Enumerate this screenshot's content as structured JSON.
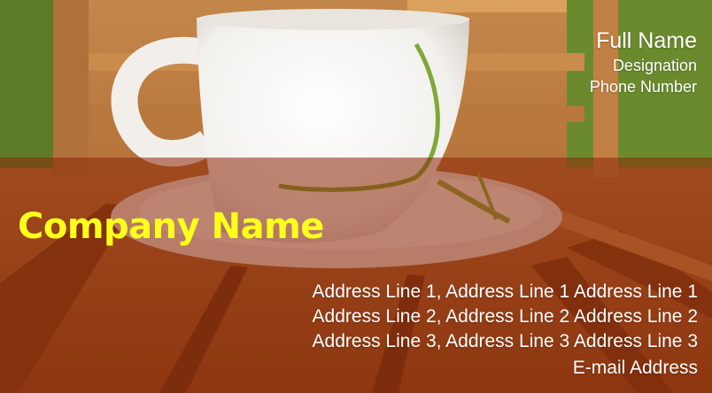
{
  "card": {
    "full_name": "Full Name",
    "designation": "Designation",
    "phone": "Phone Number",
    "company": "Company Name",
    "address_lines": [
      "Address Line 1,   Address Line 1 Address Line 1",
      "Address Line 2,   Address Line 2 Address Line 2",
      "Address Line 3,   Address Line 3 Address Line 3"
    ],
    "email": "E-mail Address"
  },
  "colors": {
    "company_text": "#ffff1c",
    "band_overlay": "#8c2608",
    "wood": "#a35a26"
  }
}
